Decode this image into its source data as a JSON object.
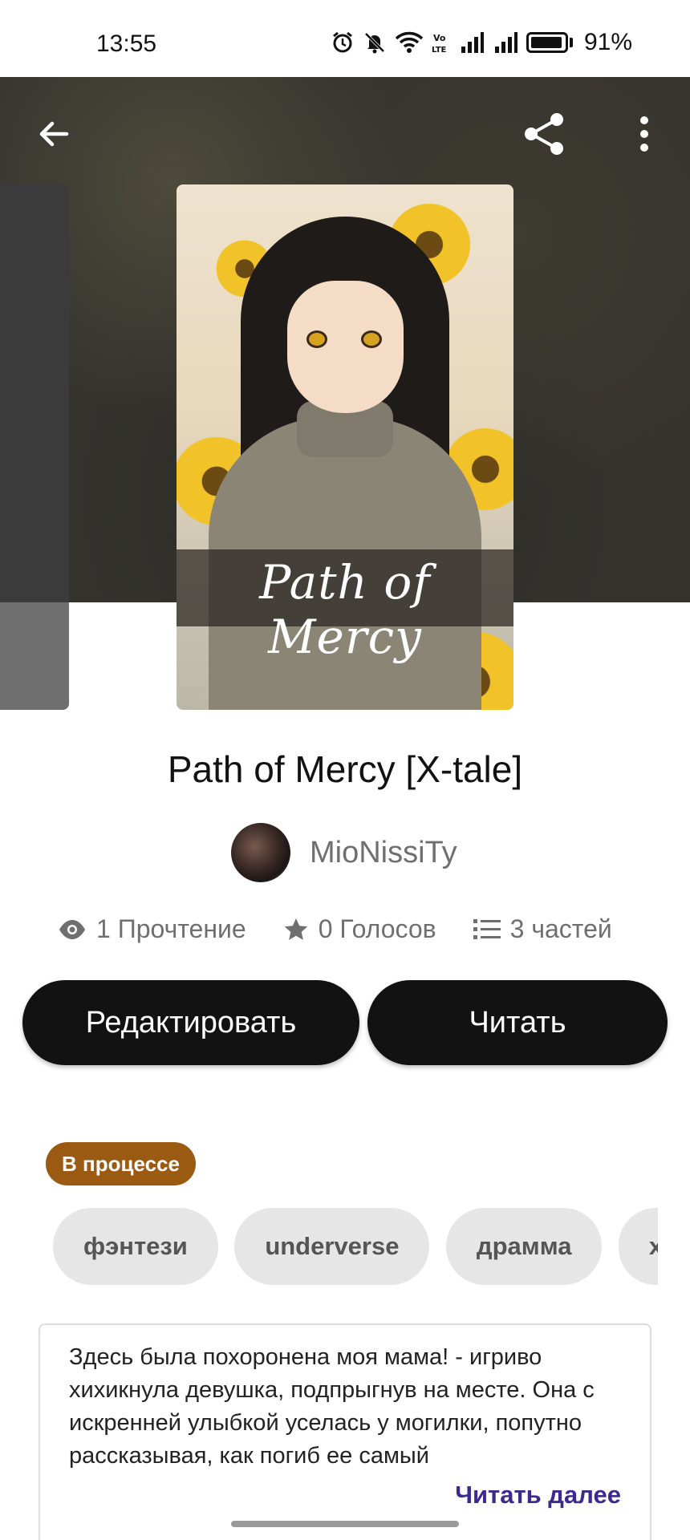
{
  "status_bar": {
    "time": "13:55",
    "battery_percent": "91%",
    "icons": [
      "alarm-icon",
      "mute-icon",
      "wifi-icon",
      "volte-icon",
      "signal-icon",
      "signal-icon",
      "battery-icon"
    ]
  },
  "header": {
    "back_icon": "arrow-left-icon",
    "share_icon": "share-icon",
    "more_icon": "more-vertical-icon"
  },
  "cover": {
    "title_art": "Path of Mercy"
  },
  "story": {
    "title": "Path of Mercy [X-tale]",
    "author": "MioNissiTy",
    "stats": {
      "reads": "1 Прочтение",
      "votes": "0 Голосов",
      "parts": "3 частей"
    }
  },
  "actions": {
    "edit_label": "Редактировать",
    "read_label": "Читать"
  },
  "status_badge": "В процессе",
  "tags": [
    "фэнтези",
    "underverse",
    "драмма",
    "х"
  ],
  "description": {
    "text": "Здесь была похоронена моя мама! - игриво хихикнула девушка, подпрыгнув на месте. Она с искренней улыбкой уселась у могилки, попутно рассказывая, как погиб ее самый",
    "read_more": "Читать далее"
  },
  "colors": {
    "button_bg": "#121212",
    "badge_bg": "#9b5a12",
    "tag_bg": "#e6e6e6",
    "link": "#3c2a8e"
  }
}
